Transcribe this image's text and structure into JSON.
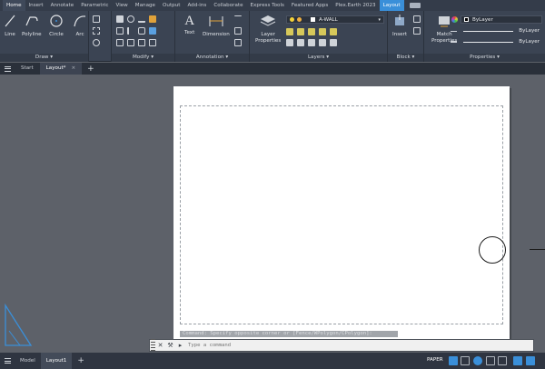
{
  "ribbon_tabs": [
    "Home",
    "Insert",
    "Annotate",
    "Parametric",
    "View",
    "Manage",
    "Output",
    "Add-ins",
    "Collaborate",
    "Express Tools",
    "Featured Apps",
    "Plex.Earth 2023",
    "Layout"
  ],
  "active_ribbon_tab": "Layout",
  "panels": {
    "draw": {
      "title": "Draw ▾",
      "tools": [
        "Line",
        "Polyline",
        "Circle",
        "Arc"
      ]
    },
    "modify": {
      "title": "Modify ▾"
    },
    "annotation": {
      "title": "Annotation ▾",
      "tools": [
        "Text",
        "Dimension"
      ]
    },
    "layers": {
      "title": "Layers ▾",
      "tool": "Layer Properties",
      "current_layer": "A-WALL"
    },
    "block": {
      "title": "Block ▾",
      "tool": "Insert"
    },
    "properties": {
      "title": "Properties ▾",
      "tool": "Match Properties",
      "color": "ByLayer",
      "linetype": "ByLayer",
      "lineweight": "ByLayer"
    }
  },
  "file_tabs": [
    {
      "label": "Start"
    },
    {
      "label": "Layout*"
    }
  ],
  "command": {
    "history": "Command: Specify opposite corner or [Fence/WPolygon/CPolygon]:",
    "placeholder": "Type a command"
  },
  "layout_tabs": [
    "Model",
    "Layout1"
  ],
  "status": {
    "space": "PAPER"
  },
  "colors": {
    "accent": "#3a8fd9",
    "ribbon_bg": "#3b4453",
    "canvas": "#5d6169",
    "paper": "#ffffff"
  }
}
